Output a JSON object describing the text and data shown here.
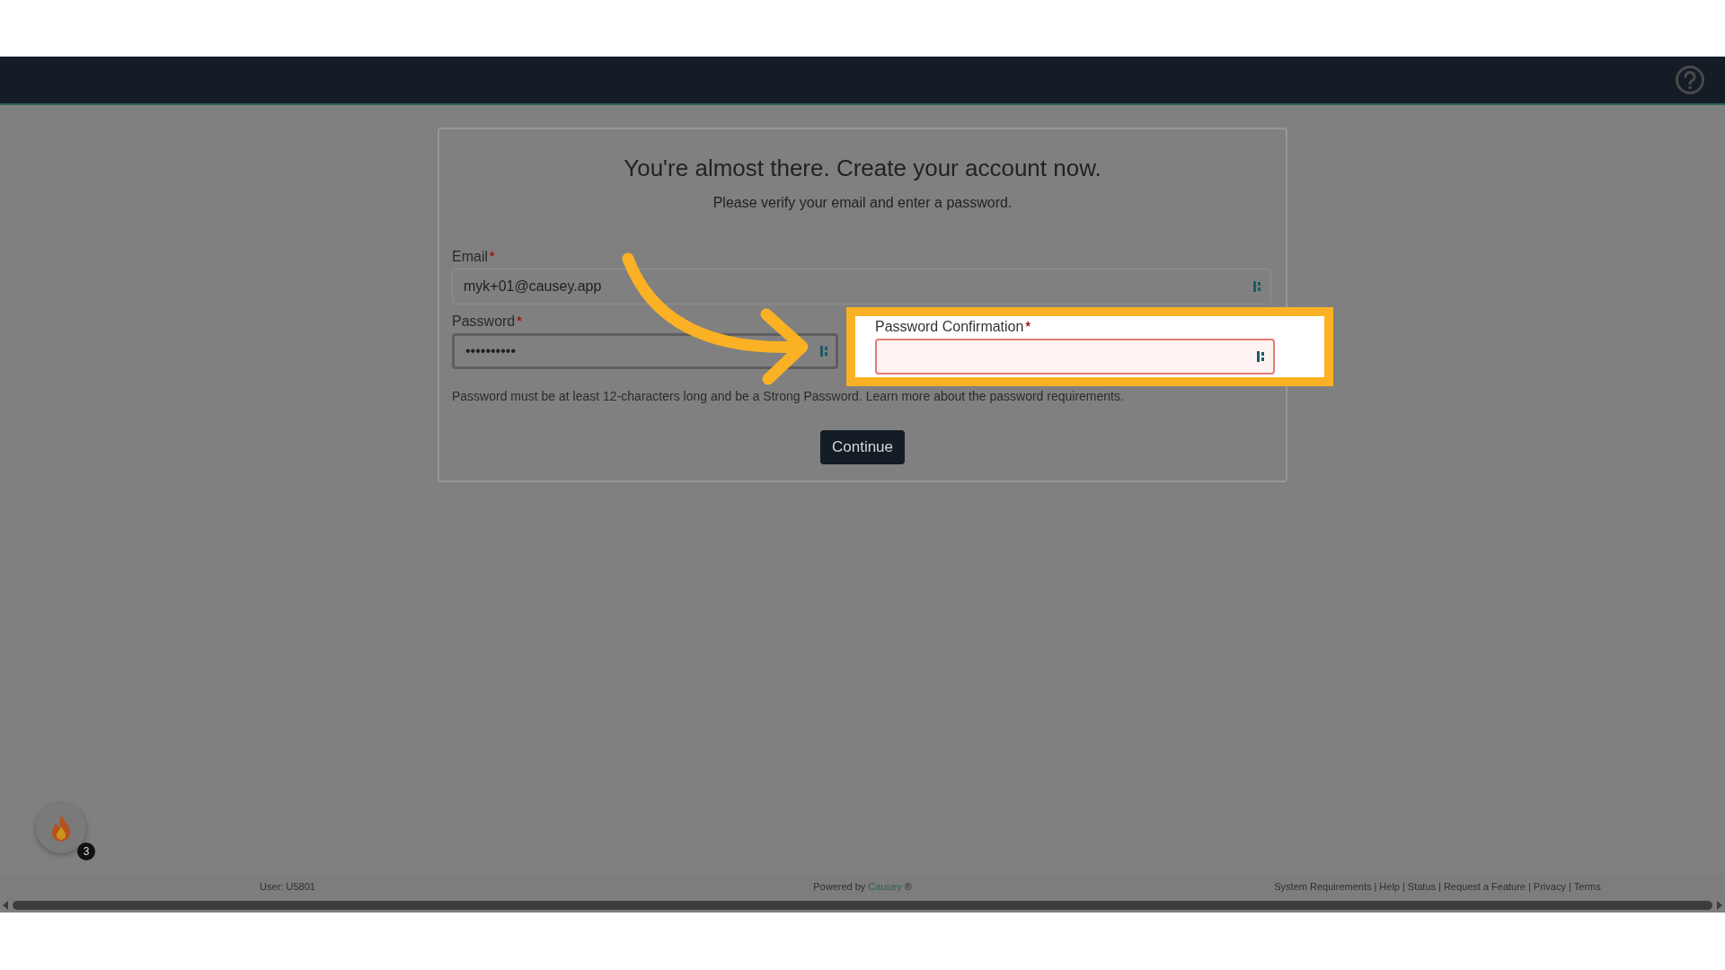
{
  "form": {
    "title": "You're almost there. Create your account now.",
    "subtitle": "Please verify your email and enter a password.",
    "fields": [
      {
        "label": "Email",
        "required_mark": "*",
        "value": "myk+01@causey.app",
        "focused": false,
        "invalid": false
      },
      {
        "label": "Password",
        "required_mark": "*",
        "value": "••••••••••",
        "focused": true,
        "invalid": false
      }
    ],
    "hint": "Password must be at least 12-characters long and be a Strong Password. Learn more about the password requirements.",
    "button": "Continue"
  },
  "highlight": {
    "label": "Password Confirmation",
    "required_mark": "*",
    "invalid": true
  },
  "notifications": {
    "count": "3"
  },
  "footer": {
    "user": "User: U5801",
    "powered_by": "Powered by",
    "brand": "Causey",
    "mark": "®",
    "separator": "|",
    "links": [
      "System Requirements",
      "Help",
      "Status",
      "Request a Feature",
      "Privacy",
      "Terms"
    ]
  }
}
